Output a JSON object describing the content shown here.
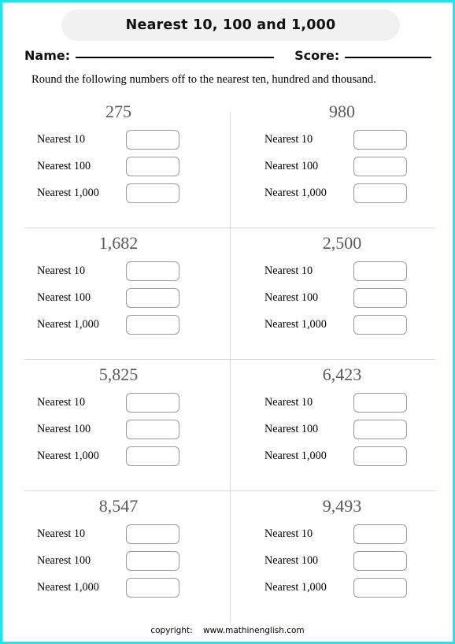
{
  "page": {
    "border_color": "#19e6f0",
    "background": "#ffffff"
  },
  "header": {
    "title": "Nearest 10, 100 and 1,000",
    "pill_color": "#f1f1f1",
    "name_label": "Name:",
    "score_label": "Score:",
    "instruction": "Round the following numbers off to the nearest ten, hundred and thousand."
  },
  "labels": {
    "nearest_10": "Nearest 10",
    "nearest_100": "Nearest 100",
    "nearest_1000": "Nearest 1,000"
  },
  "exercises": [
    {
      "number": "275",
      "rows": [
        {
          "label": "Nearest 10",
          "answer": ""
        },
        {
          "label": "Nearest 100",
          "answer": ""
        },
        {
          "label": "Nearest 1,000",
          "answer": ""
        }
      ]
    },
    {
      "number": "980",
      "rows": [
        {
          "label": "Nearest 10",
          "answer": ""
        },
        {
          "label": "Nearest 100",
          "answer": ""
        },
        {
          "label": "Nearest 1,000",
          "answer": ""
        }
      ]
    },
    {
      "number": "1,682",
      "rows": [
        {
          "label": "Nearest 10",
          "answer": ""
        },
        {
          "label": "Nearest 100",
          "answer": ""
        },
        {
          "label": "Nearest 1,000",
          "answer": ""
        }
      ]
    },
    {
      "number": "2,500",
      "rows": [
        {
          "label": "Nearest 10",
          "answer": ""
        },
        {
          "label": "Nearest 100",
          "answer": ""
        },
        {
          "label": "Nearest 1,000",
          "answer": ""
        }
      ]
    },
    {
      "number": "5,825",
      "rows": [
        {
          "label": "Nearest 10",
          "answer": ""
        },
        {
          "label": "Nearest 100",
          "answer": ""
        },
        {
          "label": "Nearest 1,000",
          "answer": ""
        }
      ]
    },
    {
      "number": "6,423",
      "rows": [
        {
          "label": "Nearest 10",
          "answer": ""
        },
        {
          "label": "Nearest 100",
          "answer": ""
        },
        {
          "label": "Nearest 1,000",
          "answer": ""
        }
      ]
    },
    {
      "number": "8,547",
      "rows": [
        {
          "label": "Nearest 10",
          "answer": ""
        },
        {
          "label": "Nearest 100",
          "answer": ""
        },
        {
          "label": "Nearest 1,000",
          "answer": ""
        }
      ]
    },
    {
      "number": "9,493",
      "rows": [
        {
          "label": "Nearest 10",
          "answer": ""
        },
        {
          "label": "Nearest 100",
          "answer": ""
        },
        {
          "label": "Nearest 1,000",
          "answer": ""
        }
      ]
    }
  ],
  "footer": {
    "copyright_label": "copyright:",
    "site": "www.mathinenglish.com"
  }
}
